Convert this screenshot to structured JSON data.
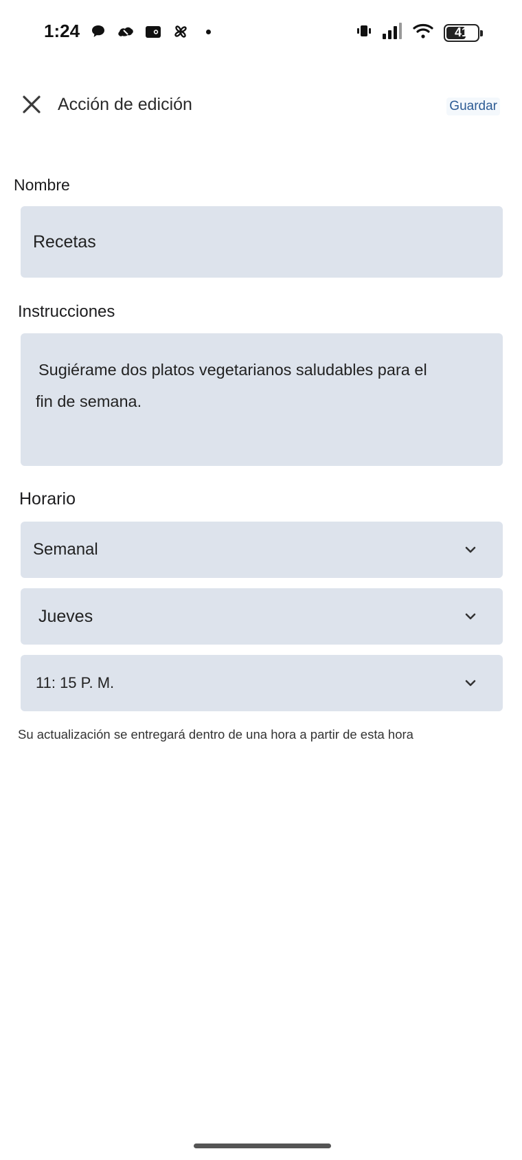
{
  "status_bar": {
    "time": "1:24",
    "battery_level": "41",
    "battery_fraction": 0.41,
    "left_icons": [
      "chat-bubble-icon",
      "cloud-app-icon",
      "wallet-icon",
      "pinwheel-icon",
      "notification-dot-icon"
    ],
    "right_icons": [
      "vibrate-icon",
      "signal-icon",
      "wifi-icon",
      "battery-icon"
    ]
  },
  "header": {
    "title": "Acción de edición",
    "save_label": "Guardar",
    "close_icon": "close-icon"
  },
  "form": {
    "name_label": "Nombre",
    "name_value": "Recetas",
    "instructions_label": "Instrucciones",
    "instructions_line1": "Sugiérame dos platos vegetarianos saludables para el",
    "instructions_line2": "fin de semana.",
    "schedule_label": "Horario",
    "frequency_value": "Semanal",
    "day_value": "Jueves",
    "time_value": "11: 15 P. M.",
    "hint": "Su actualización se entregará dentro de una hora a partir de esta hora"
  },
  "colors": {
    "field_background": "#dde3ec",
    "accent": "#2c5b94"
  }
}
